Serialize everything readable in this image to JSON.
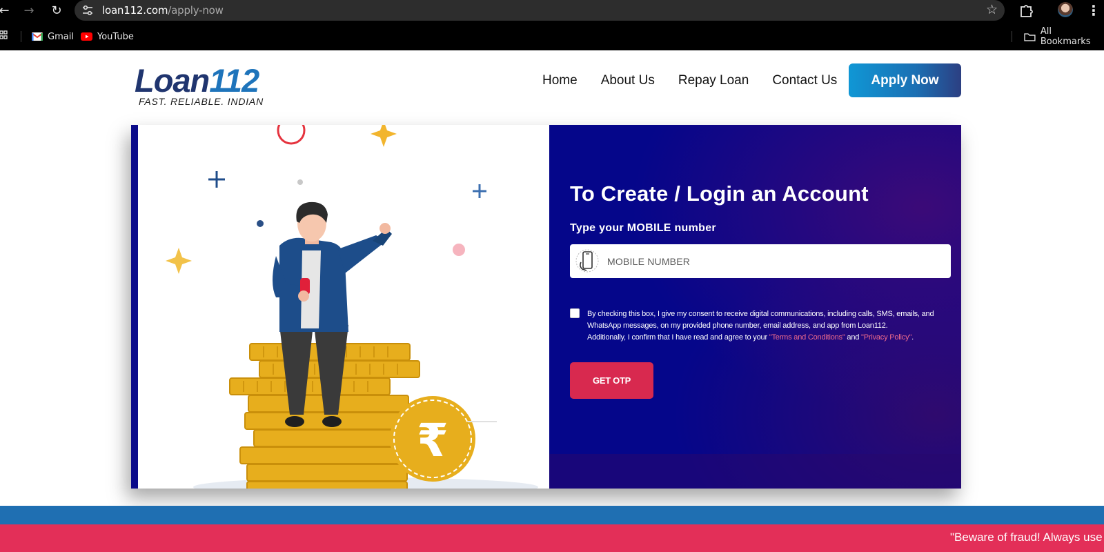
{
  "browser": {
    "url_host": "loan112.com",
    "url_path": "/apply-now",
    "bookmarks": [
      {
        "label": "Gmail",
        "icon": "gmail-icon"
      },
      {
        "label": "YouTube",
        "icon": "youtube-icon"
      }
    ],
    "all_bookmarks_label": "All Bookmarks"
  },
  "header": {
    "logo_word": "Loan",
    "logo_number": "112",
    "tagline": "FAST. RELIABLE. INDIAN",
    "nav": [
      "Home",
      "About Us",
      "Repay Loan",
      "Contact Us"
    ],
    "apply_label": "Apply Now"
  },
  "form": {
    "title": "To Create / Login an Account",
    "mobile_label": "Type your MOBILE number",
    "mobile_placeholder": "MOBILE NUMBER",
    "mobile_value": "",
    "consent_checked": false,
    "consent_line1": "By checking this box, I give my consent to receive digital communications, including calls, SMS, emails, and WhatsApp messages, on my provided phone number, email address, and app from Loan112.",
    "consent_line2": "Additionally, I confirm that I have read and agree to your ",
    "terms_label": "\"Terms and Conditions\"",
    "and_text": " and ",
    "privacy_label": "\"Privacy Policy\"",
    "end_period": ".",
    "otp_label": "GET OTP"
  },
  "illustration": {
    "rupee_symbol": "₹"
  },
  "ticker": {
    "text": "\"Beware of fraud! Always use"
  },
  "colors": {
    "brand_navy": "#20356f",
    "brand_blue": "#1e74bb",
    "panel_bg": "#05068a",
    "otp_button": "#d8294f",
    "ticker_bg": "#e32f58",
    "strip_blue": "#1f6fb2"
  }
}
